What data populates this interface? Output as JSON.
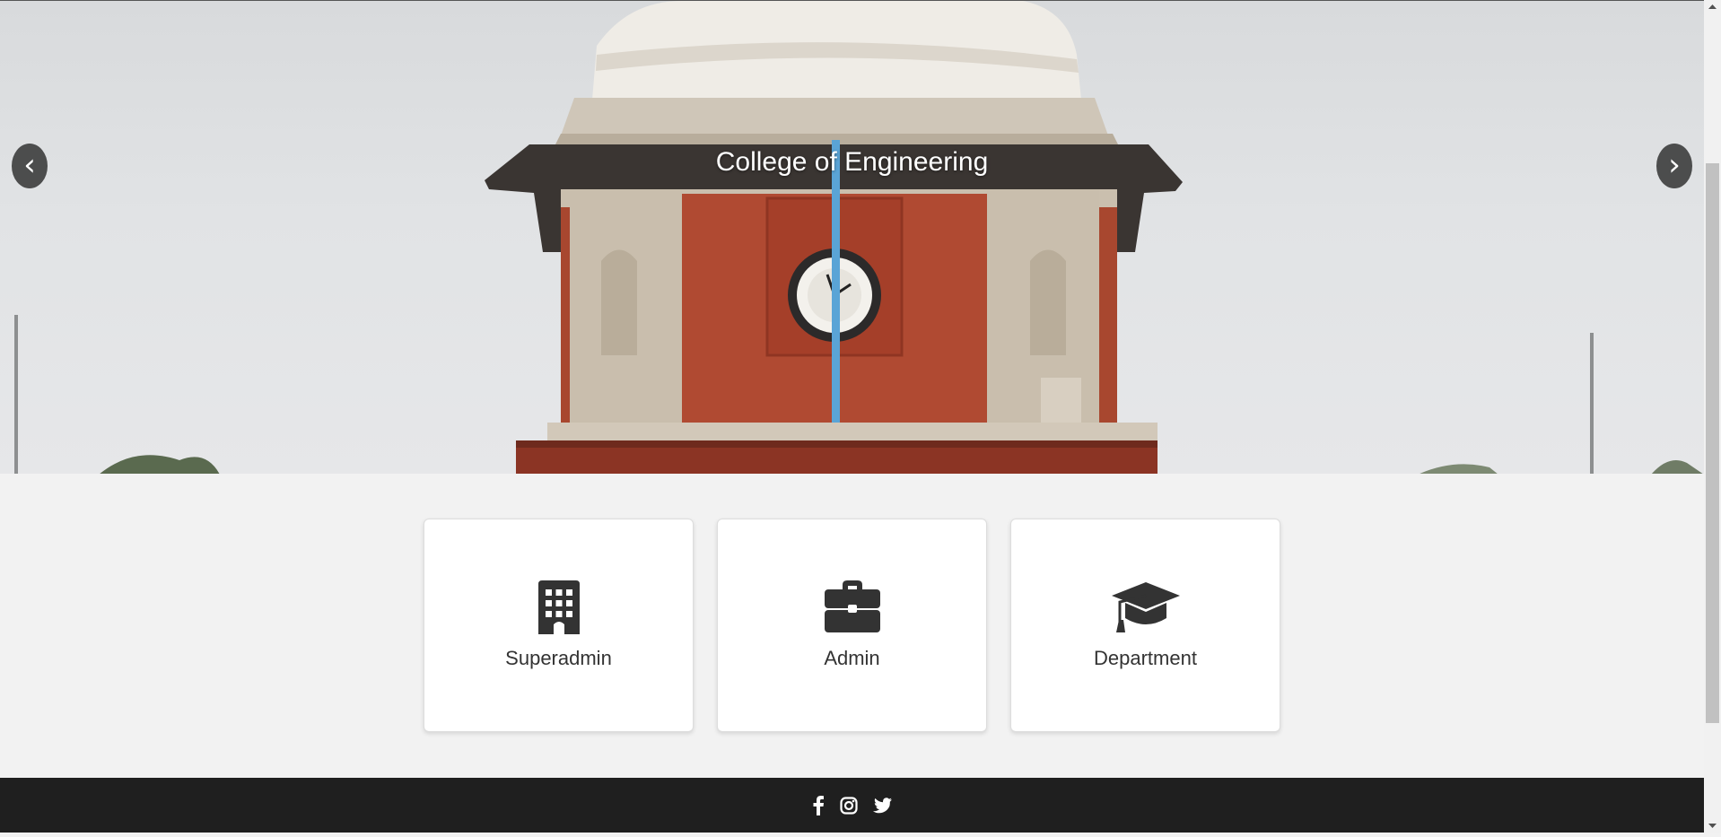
{
  "hero": {
    "title": "College of Engineering",
    "prev_label": "‹",
    "next_label": "›"
  },
  "cards": [
    {
      "label": "Superadmin",
      "icon": "building-icon"
    },
    {
      "label": "Admin",
      "icon": "briefcase-icon"
    },
    {
      "label": "Department",
      "icon": "graduation-cap-icon"
    }
  ],
  "footer": {
    "social": [
      "facebook-icon",
      "instagram-icon",
      "twitter-icon"
    ]
  },
  "colors": {
    "footer_bg": "#1f1f1f",
    "page_bg": "#f2f2f2",
    "tower_red": "#b04a32",
    "icon_dark": "#333333"
  }
}
